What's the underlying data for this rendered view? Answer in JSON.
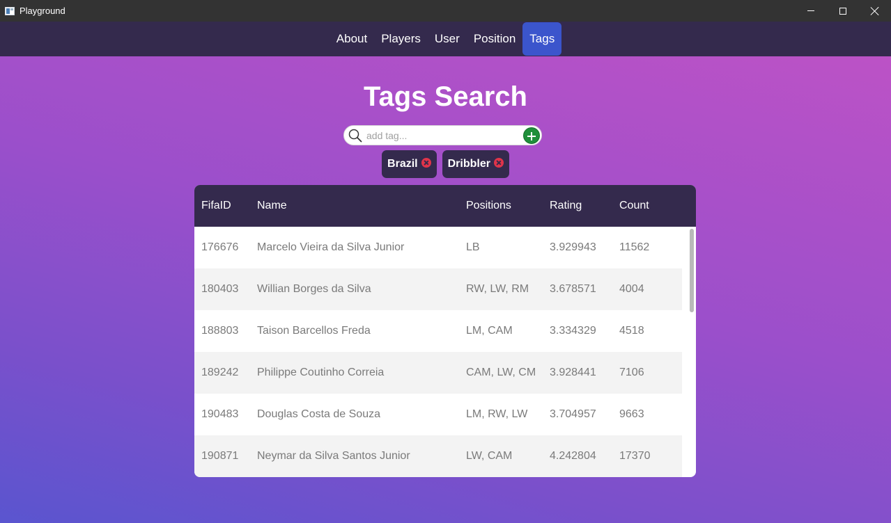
{
  "window": {
    "title": "Playground"
  },
  "nav": {
    "items": [
      {
        "label": "About",
        "active": false
      },
      {
        "label": "Players",
        "active": false
      },
      {
        "label": "User",
        "active": false
      },
      {
        "label": "Position",
        "active": false
      },
      {
        "label": "Tags",
        "active": true
      }
    ]
  },
  "page": {
    "title": "Tags Search"
  },
  "search": {
    "placeholder": "add tag...",
    "value": ""
  },
  "tags": [
    {
      "label": "Brazil"
    },
    {
      "label": "Dribbler"
    }
  ],
  "table": {
    "headers": {
      "id": "FifaID",
      "name": "Name",
      "positions": "Positions",
      "rating": "Rating",
      "count": "Count"
    },
    "rows": [
      {
        "id": "176676",
        "name": "Marcelo Vieira da Silva Junior",
        "positions": "LB",
        "rating": "3.929943",
        "count": "11562"
      },
      {
        "id": "180403",
        "name": "Willian Borges da Silva",
        "positions": "RW, LW, RM",
        "rating": "3.678571",
        "count": "4004"
      },
      {
        "id": "188803",
        "name": "Taison Barcellos Freda",
        "positions": "LM, CAM",
        "rating": "3.334329",
        "count": "4518"
      },
      {
        "id": "189242",
        "name": "Philippe Coutinho Correia",
        "positions": "CAM, LW, CM",
        "rating": "3.928441",
        "count": "7106"
      },
      {
        "id": "190483",
        "name": "Douglas Costa de Souza",
        "positions": "LM, RW, LW",
        "rating": "3.704957",
        "count": "9663"
      },
      {
        "id": "190871",
        "name": "Neymar da Silva Santos Junior",
        "positions": "LW, CAM",
        "rating": "4.242804",
        "count": "17370"
      }
    ]
  },
  "colors": {
    "nav_bg": "#342a4d",
    "nav_active": "#3b55cc",
    "add_button": "#1f8f3a",
    "tag_remove": "#e0344a"
  },
  "icons": {
    "search": "search-icon",
    "add": "plus-circle-icon",
    "remove": "close-circle-icon"
  }
}
